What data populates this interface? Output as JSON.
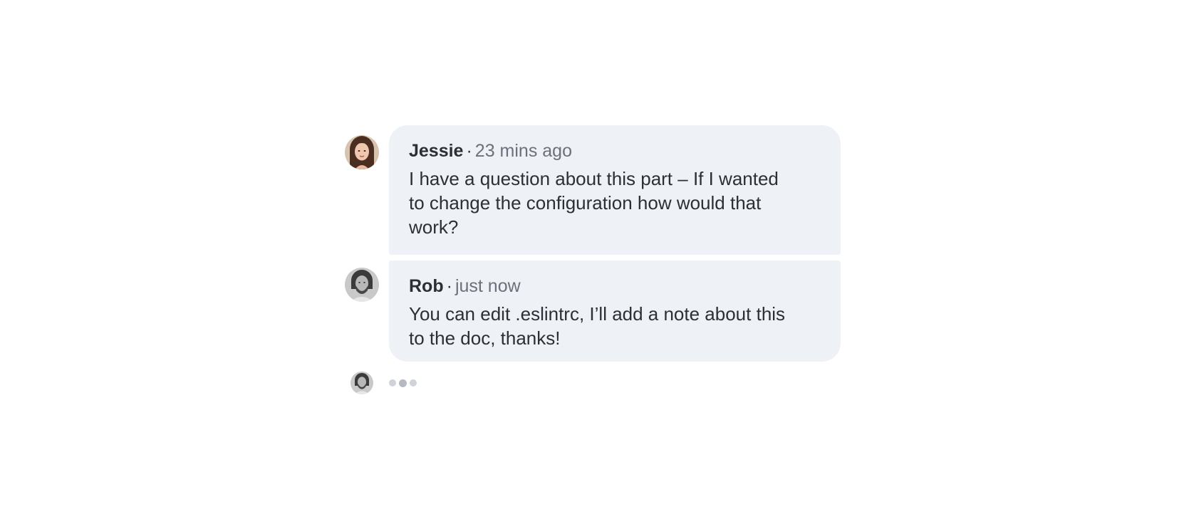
{
  "comments": [
    {
      "author": "Jessie",
      "separator": "·",
      "time": "23 mins ago",
      "text": "I have a question about this part – If I wanted to change the configuration how would that work?",
      "avatar_icon": "person-avatar-female"
    },
    {
      "author": "Rob",
      "separator": "·",
      "time": "just now",
      "text": "You can edit .eslintrc, I’ll add a note about this to the doc, thanks!",
      "avatar_icon": "person-avatar-male"
    }
  ],
  "typing_indicator": {
    "avatar_icon": "person-avatar-male",
    "dots": 3
  },
  "colors": {
    "bubble_background": "#eef1f6",
    "text": "#2c2f36",
    "muted_text": "#6b707a",
    "typing_dot": "#cfd2d8"
  }
}
